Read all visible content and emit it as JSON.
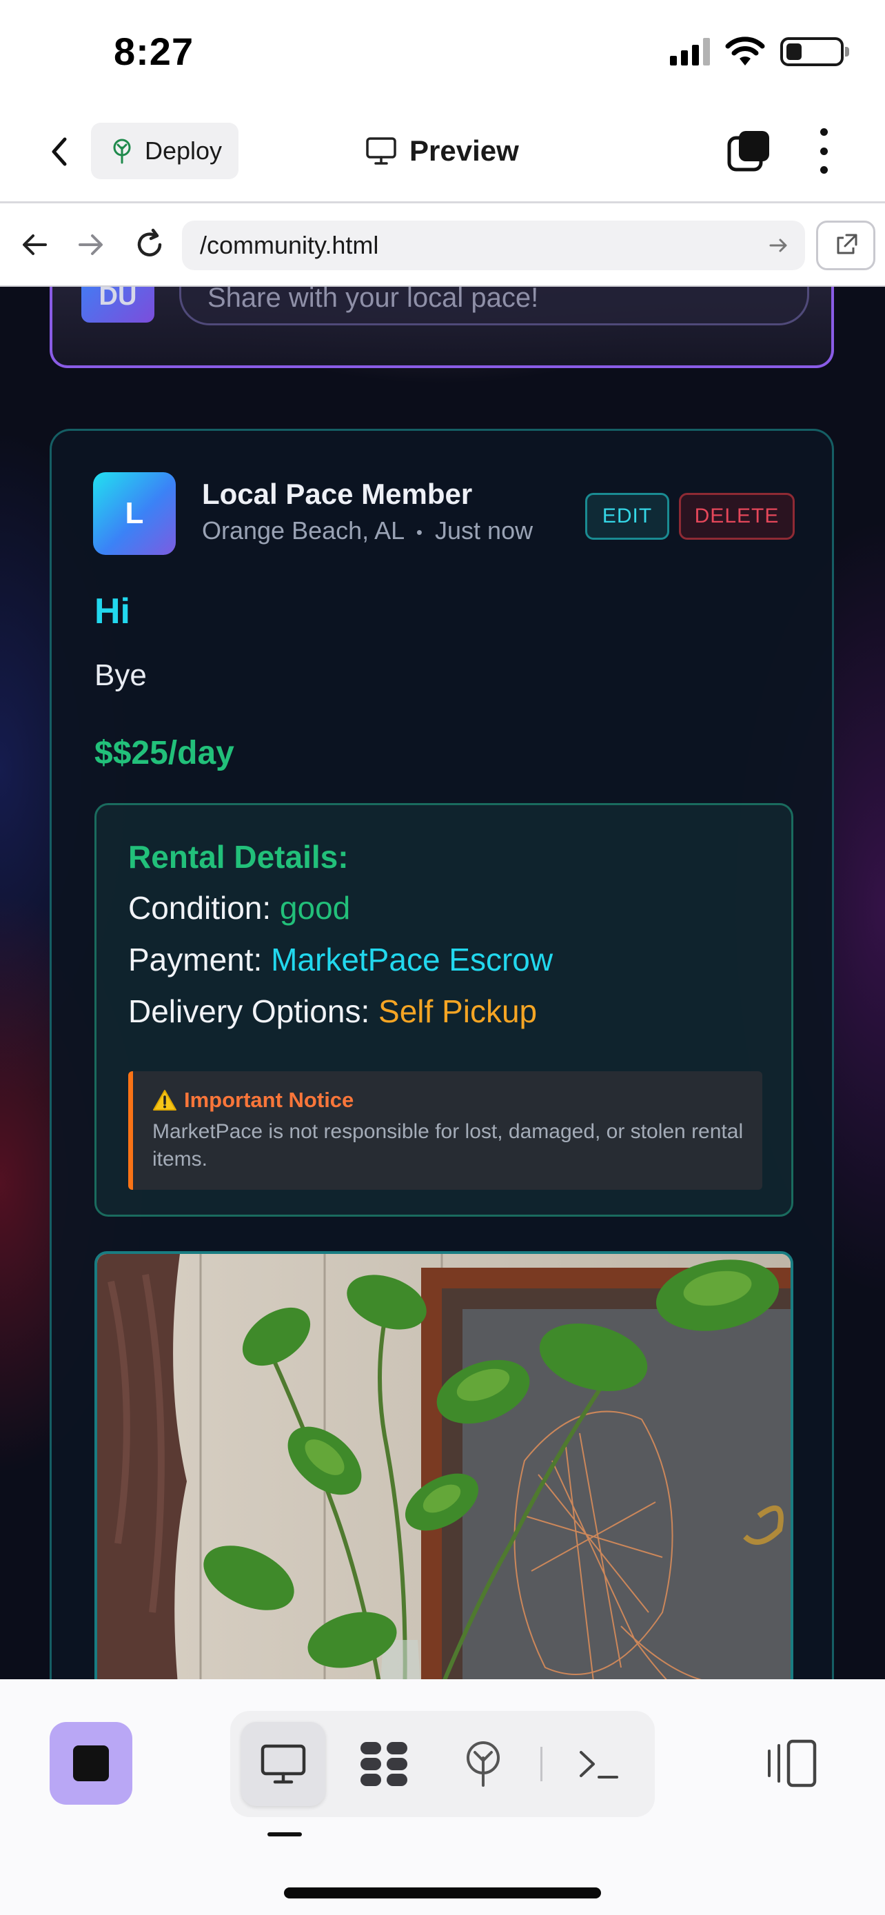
{
  "status_bar": {
    "time": "8:27"
  },
  "toolbar": {
    "deploy_label": "Deploy",
    "preview_label": "Preview"
  },
  "browser": {
    "url": "/community.html"
  },
  "composer": {
    "avatar_initials": "DU",
    "placeholder": "Share with your local pace!"
  },
  "post": {
    "avatar_letter": "L",
    "author": "Local Pace Member",
    "location": "Orange Beach, AL",
    "time": "Just now",
    "meta_separator": "•",
    "edit_label": "EDIT",
    "delete_label": "DELETE",
    "title": "Hi",
    "body": "Bye",
    "price": "$$25/day",
    "rental": {
      "heading": "Rental Details:",
      "condition_label": "Condition:",
      "condition_value": "good",
      "payment_label": "Payment:",
      "payment_value": "MarketPace Escrow",
      "delivery_label": "Delivery Options:",
      "delivery_value": "Self Pickup"
    },
    "notice": {
      "title": "Important Notice",
      "text": "MarketPace is not responsible for lost, damaged, or stolen rental items."
    }
  },
  "colors": {
    "accent_cyan": "#22d8ee",
    "accent_green": "#22c07a",
    "accent_orange": "#f5a524",
    "danger_red": "#e5475a",
    "composer_border": "#8a5ce6",
    "stop_button": "#b9a7f5"
  }
}
